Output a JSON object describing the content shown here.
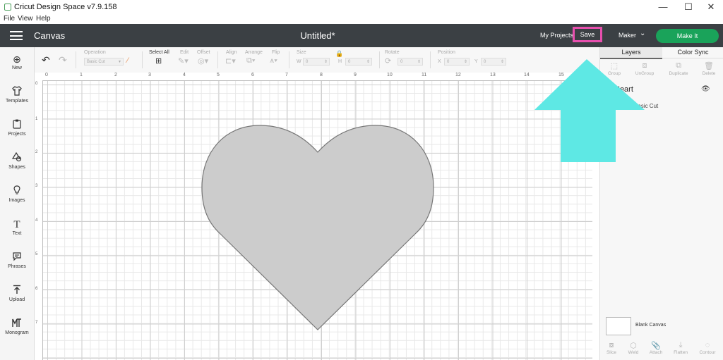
{
  "window": {
    "title": "Cricut Design Space  v7.9.158",
    "minimize_glyph": "—",
    "maximize_glyph": "☐",
    "close_glyph": "✕"
  },
  "menubar": {
    "items": [
      "File",
      "View",
      "Help"
    ]
  },
  "header": {
    "canvas_label": "Canvas",
    "document_title": "Untitled*",
    "my_projects": "My Projects",
    "save": "Save",
    "machine": "Maker",
    "make_it": "Make It"
  },
  "leftrail": {
    "items": [
      {
        "label": "New",
        "icon": "plus-circle-icon",
        "glyph": "⊕"
      },
      {
        "label": "Templates",
        "icon": "shirt-icon",
        "glyph": "👕"
      },
      {
        "label": "Projects",
        "icon": "clipboard-icon",
        "glyph": "📋"
      },
      {
        "label": "Shapes",
        "icon": "shapes-icon",
        "glyph": "△"
      },
      {
        "label": "Images",
        "icon": "bulb-icon",
        "glyph": "💡"
      },
      {
        "label": "Text",
        "icon": "text-icon",
        "glyph": "T"
      },
      {
        "label": "Phrases",
        "icon": "speech-bubble-icon",
        "glyph": "💬"
      },
      {
        "label": "Upload",
        "icon": "upload-icon",
        "glyph": "⤒"
      },
      {
        "label": "Monogram",
        "icon": "monogram-icon",
        "glyph": "ℳ"
      }
    ]
  },
  "toolbar": {
    "operation_label": "Operation",
    "operation_value": "Basic Cut",
    "select_all": "Select All",
    "edit": "Edit",
    "offset": "Offset",
    "align": "Align",
    "arrange": "Arrange",
    "flip": "Flip",
    "size": "Size",
    "w_label": "W",
    "h_label": "H",
    "w_value": "0",
    "h_value": "0",
    "rotate": "Rotate",
    "rotate_value": "0",
    "position": "Position",
    "x_label": "X",
    "y_label": "Y",
    "x_value": "0",
    "y_value": "0"
  },
  "ruler": {
    "h_labels": [
      "0",
      "1",
      "2",
      "3",
      "4",
      "5",
      "6",
      "7",
      "8",
      "9",
      "10",
      "11",
      "12",
      "13",
      "14",
      "15"
    ],
    "v_labels": [
      "0",
      "1",
      "2",
      "3",
      "4",
      "5",
      "6",
      "7"
    ]
  },
  "rightpanel": {
    "tabs": [
      "Layers",
      "Color Sync"
    ],
    "tools": [
      "Group",
      "UnGroup",
      "Duplicate",
      "Delete"
    ],
    "layer_title": "Heart",
    "layer_subtitle": "Basic Cut",
    "blank_canvas": "Blank Canvas",
    "bottom_tools": [
      "Slice",
      "Weld",
      "Attach",
      "Flatten",
      "Contour"
    ]
  },
  "colors": {
    "header_bg": "#3b4044",
    "make_it_green": "#1aa35a",
    "save_highlight": "#e74fae",
    "arrow_cyan": "#5ee8e4",
    "heart_fill": "#cccccc"
  }
}
